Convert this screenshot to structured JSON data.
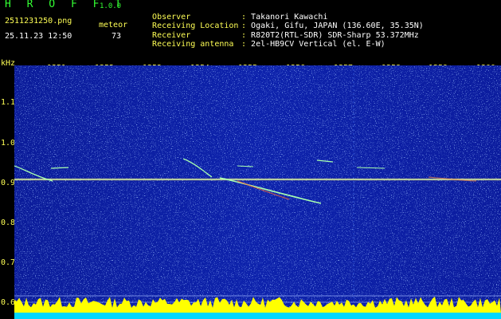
{
  "header": {
    "app_title": "H R O F F T",
    "version": "1.0.0",
    "file_name": "2511231250.png",
    "meteor_label": "meteor",
    "timestamp": "25.11.23 12:50",
    "meteor_count": "73"
  },
  "info": [
    {
      "label": "Observer",
      "value": "Takanori Kawachi"
    },
    {
      "label": "Receiving Location",
      "value": "Ogaki, Gifu, JAPAN (136.60E, 35.35N)"
    },
    {
      "label": "Receiver",
      "value": "R820T2(RTL-SDR) SDR-Sharp 53.372MHz"
    },
    {
      "label": "Receiving antenna",
      "value": "2el-HB9CV Vertical (el. E-W)"
    }
  ],
  "colon": ":",
  "axis": {
    "unit": "kHz",
    "x_ticks": [
      "1251",
      "1252",
      "1253",
      "1254",
      "1255",
      "1256",
      "1257",
      "1258",
      "1259",
      "1300"
    ],
    "y_ticks": [
      "1.1",
      "1.0",
      "0.9",
      "0.8",
      "0.7",
      "0.6"
    ]
  },
  "colors": {
    "background": "#000000",
    "spectrogram_bg": "#0a1fa8",
    "label_yellow": "#ffff55",
    "title_green": "#33ff33",
    "trace": "#c8ffc8",
    "level_fill": "#ffff00",
    "level_base": "#00d8ff"
  }
}
